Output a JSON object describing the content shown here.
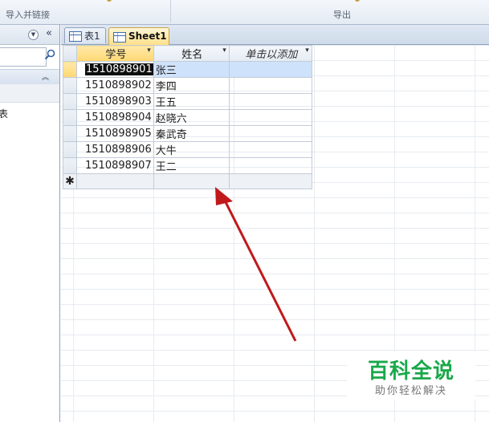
{
  "ribbon": {
    "group1_label": "导入并链接",
    "group2_label": "导出"
  },
  "nav": {
    "dropdown_icon": "chevron-down-circle-icon",
    "collapse_icon": "double-chevron-left-icon",
    "search_placeholder": "",
    "search_icon": "search-icon",
    "group_chevron_icon": "double-chevron-up-icon",
    "item_partial_text": "表"
  },
  "tabs": [
    {
      "label": "表1",
      "icon": "table-icon",
      "active": false
    },
    {
      "label": "Sheet1",
      "icon": "table-icon",
      "active": true
    }
  ],
  "datasheet": {
    "columns": [
      {
        "label": "学号",
        "sort_arrow": "▾"
      },
      {
        "label": "姓名",
        "sort_arrow": "▾"
      },
      {
        "label": "单击以添加",
        "sort_arrow": "▾"
      }
    ],
    "rows": [
      {
        "id": "1510898901",
        "name": "张三"
      },
      {
        "id": "1510898902",
        "name": "李四"
      },
      {
        "id": "1510898903",
        "name": "王五"
      },
      {
        "id": "1510898904",
        "name": "赵晓六"
      },
      {
        "id": "1510898905",
        "name": "秦武奇"
      },
      {
        "id": "1510898906",
        "name": "大牛"
      },
      {
        "id": "1510898907",
        "name": "王二"
      }
    ],
    "new_row_marker": "✱"
  },
  "annotation": {
    "arrow_color": "#c0191c"
  },
  "watermark": {
    "title": "百科全说",
    "subtitle": "助你轻松解决",
    "title_color": "#1aa84a"
  },
  "colors": {
    "active_tab": "#ffe08a",
    "selected_row": "#cfe2fb",
    "header": "#e4ebf3"
  }
}
